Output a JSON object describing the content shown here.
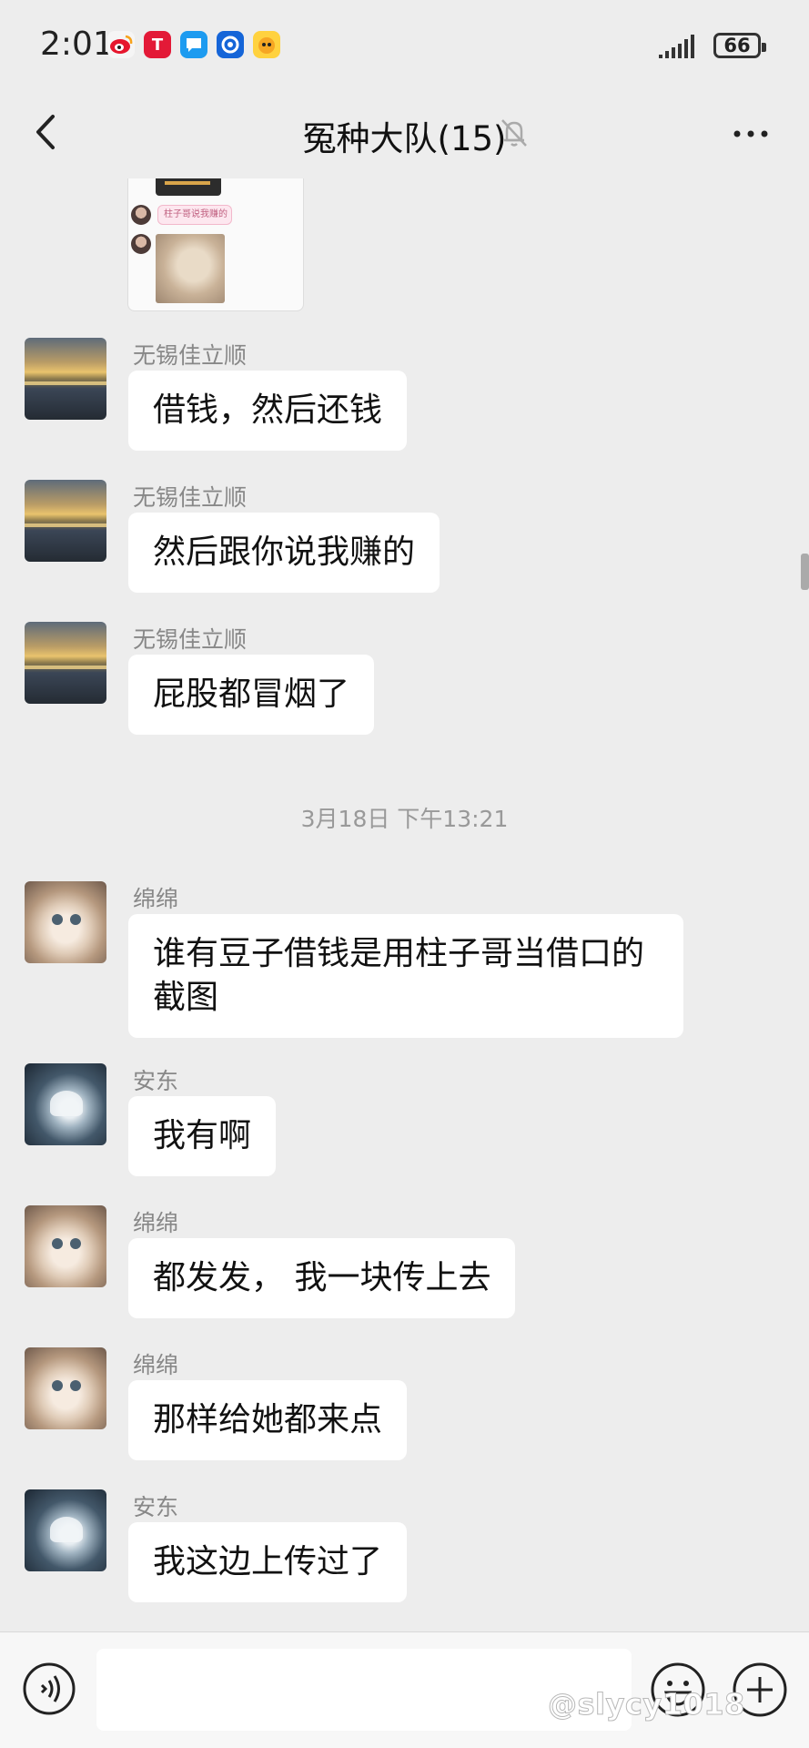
{
  "status_bar": {
    "time": "2:01",
    "apps": [
      "weibo-icon",
      "tesla-icon",
      "chat-app-icon",
      "browser-icon",
      "game-icon"
    ],
    "battery": "66"
  },
  "header": {
    "title": "冤种大队(15)",
    "icons": [
      "back-arrow-icon",
      "mute-bell-icon",
      "more-icon"
    ]
  },
  "shared_image": {
    "caption": "柱子哥说我赚的"
  },
  "messages": [
    {
      "sender": "无锡佳立顺",
      "text": "借钱，然后还钱"
    },
    {
      "sender": "无锡佳立顺",
      "text": "然后跟你说我赚的"
    },
    {
      "sender": "无锡佳立顺",
      "text": "屁股都冒烟了"
    },
    {
      "sender": "绵绵",
      "text": "谁有豆子借钱是用柱子哥当借口的截图"
    },
    {
      "sender": "安东",
      "text": "我有啊"
    },
    {
      "sender": "绵绵",
      "text": "都发发， 我一块传上去"
    },
    {
      "sender": "绵绵",
      "text": "那样给她都来点"
    },
    {
      "sender": "安东",
      "text": "我这边上传过了"
    }
  ],
  "timestamp": "3月18日 下午13:21",
  "input_bar": {
    "icons": [
      "voice-icon",
      "emoji-icon",
      "plus-icon"
    ]
  },
  "watermark": "@slycy1018",
  "colors": {
    "background": "#ededed",
    "bubble": "#ffffff",
    "meta_text": "#888888"
  }
}
